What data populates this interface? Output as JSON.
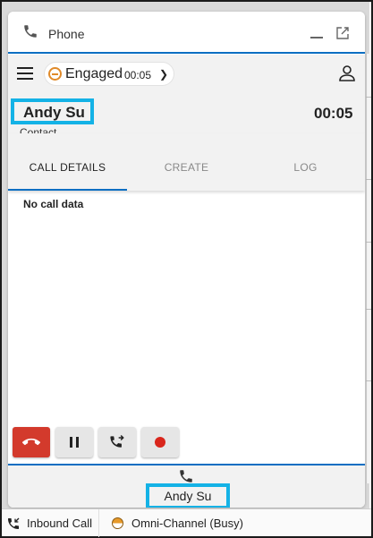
{
  "app": {
    "title": "Phone"
  },
  "status": {
    "label": "Engaged",
    "timer": "00:05"
  },
  "contact": {
    "name": "Andy Su",
    "type": "Contact",
    "call_timer": "00:05"
  },
  "tabs": [
    {
      "label": "CALL DETAILS",
      "active": true
    },
    {
      "label": "CREATE",
      "active": false
    },
    {
      "label": "LOG",
      "active": false
    }
  ],
  "call_details": {
    "empty_text": "No call data"
  },
  "call_controls": [
    "end-call",
    "hold",
    "transfer",
    "record"
  ],
  "bottom_bar": {
    "name": "Andy Su"
  },
  "utility_bar": {
    "items": [
      {
        "label": "Inbound Call",
        "icon": "inbound-call-icon"
      },
      {
        "label": "Omni-Channel (Busy)",
        "icon": "omni-status-icon"
      }
    ]
  },
  "colors": {
    "accent": "#0a6ec2",
    "highlight": "#14b2e6",
    "end_call": "#d33a2c",
    "busy": "#e08a2a"
  }
}
